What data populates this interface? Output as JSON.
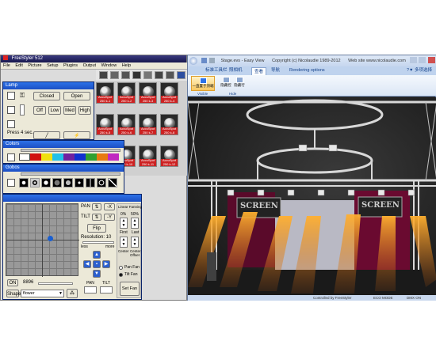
{
  "freestyler": {
    "title": "FreeStyler 512",
    "menu": [
      "File",
      "Edit",
      "Picture",
      "Setup",
      "Plugins",
      "Output",
      "Window",
      "Help"
    ],
    "fixtures": [
      {
        "line1": "AccuSpot",
        "line2": "250 k-1"
      },
      {
        "line1": "AccuSpot",
        "line2": "250 k-2"
      },
      {
        "line1": "AccuSpot",
        "line2": "250 k-3"
      },
      {
        "line1": "AccuSpot",
        "line2": "250 k-4"
      },
      {
        "line1": "AccuSpot",
        "line2": "250 k-5"
      },
      {
        "line1": "AccuSpot",
        "line2": "250 k-6"
      },
      {
        "line1": "AccuSpot",
        "line2": "250 k-7"
      },
      {
        "line1": "AccuSpot",
        "line2": "250 k-8"
      },
      {
        "line1": "AccuSpot",
        "line2": "250 k-9"
      },
      {
        "line1": "AccuSpot",
        "line2": "250 k-10"
      },
      {
        "line1": "AccuSpot",
        "line2": "250 k-11"
      },
      {
        "line1": "AccuSpot",
        "line2": "250 k-12"
      }
    ],
    "lamp": {
      "title": "Lamp",
      "closed": "Closed",
      "open": "Open",
      "off": "Off",
      "low": "Low",
      "med": "Med",
      "high": "High",
      "press_label": "Press 4 sec."
    },
    "colors": {
      "title": "Colors"
    },
    "gobos": {
      "title": "Gobos"
    },
    "pantilt": {
      "pan": "PAN",
      "tilt": "TILT",
      "minus_x": "-X",
      "minus_y": "-Y",
      "flip": "Flip",
      "resolution": "Resolution: 10",
      "less": "less",
      "more": "more",
      "pan_small": "PAN",
      "tilt_small": "TILT",
      "on": "ON",
      "value": "8896",
      "shape": "Shape",
      "shape_value": "flower",
      "linear_fanning": "Linear Fanning",
      "pct1": "0%",
      "pct2": "50%",
      "first": "First",
      "last": "Last",
      "center": "Center",
      "center_offset": "Center Offset",
      "pan_fan": "Pan Fan",
      "tilt_fan": "Tilt Fan",
      "set_fan": "Set Fan"
    }
  },
  "viewer": {
    "title_doc": "Stage.evs - Easy View",
    "title_copy": "Copyright (c) Nicolaudie 1989-2012",
    "title_web": "Web site www.nicolaudie.com",
    "tabs": [
      "标准工具栏",
      "照相机",
      "查看",
      "导航",
      "Rendering options"
    ],
    "right_menu": "多项选择",
    "ribbon_btns": [
      "一直置于顶端",
      "隐藏控",
      "隐藏行"
    ],
    "group_visible": "Visible",
    "group_hide": "Hide",
    "screen_label": "SCREEN",
    "status_left": "Controlled by FreeStyler",
    "status_mid": "ECO MODE",
    "status_right": "DMX ON"
  },
  "colors_accent": {
    "blue": "#2d72e8",
    "xp_face": "#ece9d8",
    "fixture_red": "#cc2222",
    "beam": "#e8901e"
  }
}
